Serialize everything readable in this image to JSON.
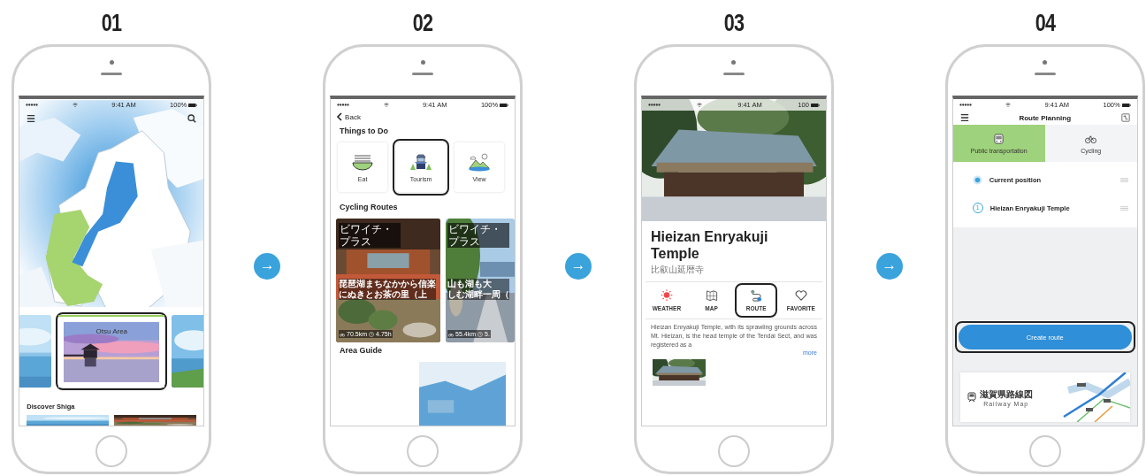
{
  "steps": [
    {
      "number": "01",
      "screen": {
        "kind": "map",
        "status": {
          "time": "9:41 AM",
          "battery": "100%"
        },
        "cards": [
          {
            "kind": "picture",
            "highlighted": false
          },
          {
            "kind": "area",
            "title": "Otsu Area",
            "highlighted": true
          },
          {
            "kind": "picture",
            "highlighted": false
          }
        ],
        "section": "Discover Shiga"
      }
    },
    {
      "number": "02",
      "screen": {
        "kind": "list",
        "status": {
          "time": "9:41 AM",
          "battery": "100%"
        },
        "back": "Back",
        "things_title": "Things to Do",
        "categories": [
          {
            "label": "Eat",
            "highlighted": false
          },
          {
            "label": "Tourism",
            "highlighted": true
          },
          {
            "label": "View",
            "highlighted": false
          }
        ],
        "routes_title": "Cycling Routes",
        "routes": [
          {
            "tag": "ビワイチ・プラス",
            "title": "琵琶湖まちなかから信楽",
            "title_2": "にぬきとお茶の里（上",
            "distance": "70.5km",
            "duration": "4.75h"
          },
          {
            "tag": "ビワイチ・プラス",
            "title": "山も湖も大",
            "title_2": "しむ湖畔一周（",
            "distance": "55.4km",
            "duration": "5."
          }
        ],
        "area_title": "Area Guide"
      }
    },
    {
      "number": "03",
      "screen": {
        "kind": "detail",
        "status": {
          "time": "9:41 AM",
          "battery": "100"
        },
        "title": "Hieizan Enryakuji Temple",
        "subtitle": "比叡山延暦寺",
        "actions": [
          {
            "label": "WEATHER",
            "highlighted": false
          },
          {
            "label": "MAP",
            "highlighted": false
          },
          {
            "label": "ROUTE",
            "highlighted": true
          },
          {
            "label": "FAVORITE",
            "highlighted": false
          }
        ],
        "description": "Hieizan Enryakuji Temple, with its sprawling grounds across Mt. Hieizan, is the head temple of the Tendai Sect, and was registered as a",
        "more": "more"
      }
    },
    {
      "number": "04",
      "screen": {
        "kind": "route",
        "status": {
          "time": "9:41 AM",
          "battery": "100%"
        },
        "title": "Route Planning",
        "modes": [
          {
            "label": "Public transportation",
            "selected": true
          },
          {
            "label": "Cycling",
            "selected": false
          }
        ],
        "stops": [
          {
            "kind": "current",
            "label": "Current position"
          },
          {
            "kind": "destination",
            "marker": "1",
            "label": "Hieizan Enryakuji Temple"
          }
        ],
        "button": {
          "label": "Create route",
          "highlighted": true
        },
        "banner": {
          "title": "滋賀県路線図",
          "subtitle": "Railway Map"
        }
      }
    }
  ],
  "arrows": [
    "→",
    "→",
    "→"
  ]
}
